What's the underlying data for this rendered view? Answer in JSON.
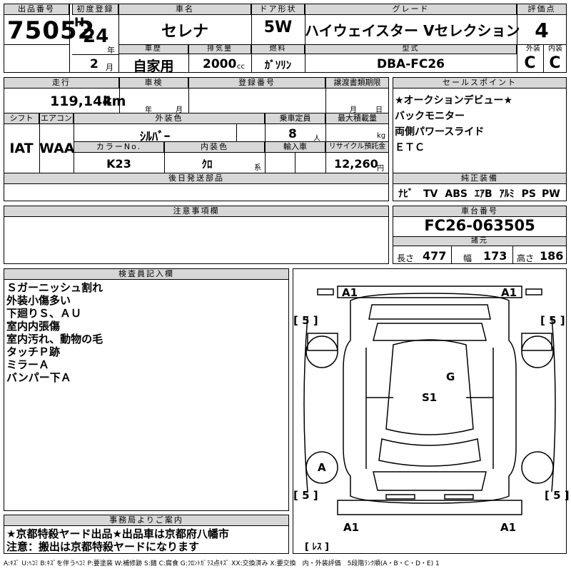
{
  "header": {
    "lot_label": "出品番号",
    "lot_value": "75052",
    "first_reg_label": "初度登録",
    "era": "H",
    "year": "24",
    "year_unit": "年",
    "month": "2",
    "month_unit": "月",
    "car_name_label": "車名",
    "car_name": "セレナ",
    "door_label": "ドア形状",
    "door": "5W",
    "grade_label": "グレード",
    "grade": "ハイウェイスター Vセレクション",
    "score_label": "評価点",
    "score": "4",
    "history_label": "車歴",
    "history": "自家用",
    "displacement_label": "排気量",
    "displacement": "2000",
    "displacement_unit": "cc",
    "fuel_label": "燃料",
    "fuel": "ｶﾞｿﾘﾝ",
    "model_label": "型式",
    "model": "DBA-FC26",
    "ext_label": "外装",
    "ext": "C",
    "int_label": "内装",
    "int": "C"
  },
  "mid": {
    "mileage_label": "走行",
    "mileage": "119,144",
    "mileage_unit": "km",
    "inspection_label": "車検",
    "insp_year_unit": "年",
    "insp_month_unit": "月",
    "reg_no_label": "登録番号",
    "transfer_label": "譲渡書類期限",
    "transfer_month_unit": "月",
    "transfer_day_unit": "日",
    "shift_label": "シフト",
    "shift": "IAT",
    "ac_label": "エアコン",
    "ac": "WAA",
    "color_label": "外装色",
    "color": "ｼﾙﾊﾞｰ",
    "capacity_label": "乗車定員",
    "capacity": "8",
    "capacity_unit": "人",
    "maxload_label": "最大積載量",
    "maxload_unit": "kg",
    "colorno_label": "カラーNo.",
    "colorno": "K23",
    "interior_label": "内装色",
    "interior": "ｸﾛ",
    "interior_unit": "系",
    "import_label": "輸入車",
    "recycle_label": "リサイクル預託金",
    "recycle": "12,260",
    "recycle_unit": "円",
    "later_label": "後日発送部品"
  },
  "sales": {
    "label": "セールスポイント",
    "items": [
      "★オークションデビュー★",
      "バックモニター",
      "両側パワースライド",
      "ＥＴＣ"
    ]
  },
  "equip": {
    "label": "純正装備",
    "items": [
      "ﾅﾋﾞ",
      "TV",
      "ABS",
      "ｴｱB",
      "ｱﾙﾐ",
      "PS",
      "PW"
    ]
  },
  "caution": {
    "label": "注意事項欄"
  },
  "chassis": {
    "label": "車台番号",
    "value": "FC26-063505",
    "spec_label": "諸元",
    "len_label": "長さ",
    "len": "477",
    "wid_label": "幅",
    "wid": "173",
    "hgt_label": "高さ",
    "hgt": "186"
  },
  "inspector": {
    "label": "検査員記入欄",
    "lines": [
      "Ｓガーニッシュ割れ",
      "外装小傷多い",
      "下廻りＳ、ＡＵ",
      "室内内張傷",
      "室内汚れ、動物の毛",
      "タッチＰ跡",
      "ミラーＡ",
      "バンパー下Ａ"
    ]
  },
  "diagram": {
    "marks": [
      "A1",
      "A1",
      "[ 5 ]",
      "[ 5 ]",
      "G",
      "S1",
      "A",
      "[ 5 ]",
      "[ 5 ]",
      "A1",
      "A1",
      "[ ﾚｽ ]"
    ]
  },
  "office": {
    "label": "事務局よりご案内",
    "lines": [
      "★京都特殺ヤード出品★出品車は京都府八幡市",
      "注意：搬出は京都特殺ヤードになります"
    ]
  },
  "legend": "A:ｷｽﾞ U:ﾍｺﾐ B:ｷｽﾞを伴うﾍｺﾐ P:要塗装 W:補修跡 S:錆 C:腐食 G:ﾌﾛﾝﾄｶﾞﾗｽ点ｷｽﾞ XX:交換済み X:要交換　内・外装評価　5段階ﾗﾝｸ順(A・B・C・D・E) 1"
}
